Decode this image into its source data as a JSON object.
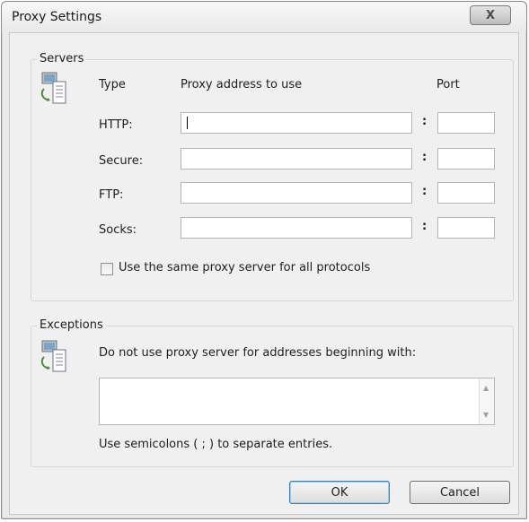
{
  "window": {
    "title": "Proxy Settings",
    "close_glyph": "X"
  },
  "servers": {
    "group_label": "Servers",
    "icon": "network-computer-icon",
    "headers": {
      "type": "Type",
      "address": "Proxy address to use",
      "port": "Port"
    },
    "rows": [
      {
        "label": "HTTP:",
        "address": "",
        "port": ""
      },
      {
        "label": "Secure:",
        "address": "",
        "port": ""
      },
      {
        "label": "FTP:",
        "address": "",
        "port": ""
      },
      {
        "label": "Socks:",
        "address": "",
        "port": ""
      }
    ],
    "colon": ":",
    "same_proxy_label": "Use the same proxy server for all protocols",
    "same_proxy_checked": false
  },
  "exceptions": {
    "group_label": "Exceptions",
    "icon": "network-computer-icon",
    "description": "Do not use proxy server for addresses beginning with:",
    "value": "",
    "hint": "Use semicolons ( ; ) to separate entries."
  },
  "buttons": {
    "ok": "OK",
    "cancel": "Cancel"
  }
}
